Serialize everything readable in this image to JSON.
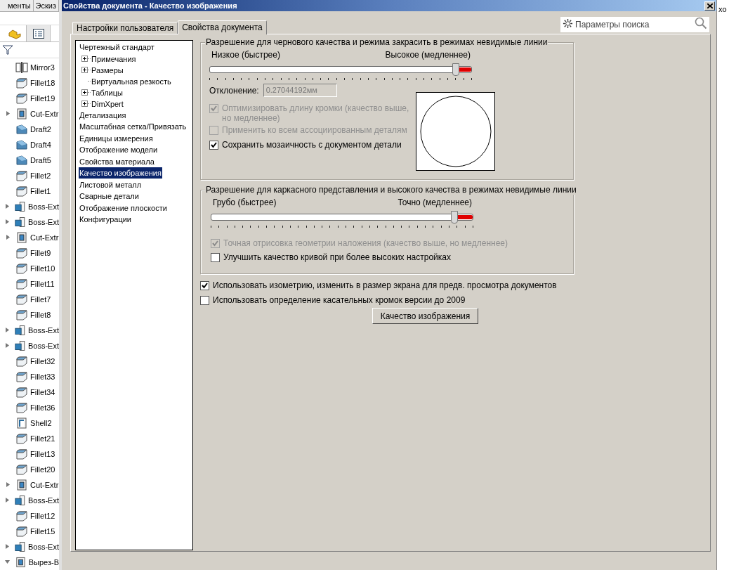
{
  "feature_panel": {
    "top_tabs": [
      {
        "label": "менты",
        "selected": false
      },
      {
        "label": "Эскиз",
        "selected": false
      }
    ],
    "view_tabs": [
      {
        "kind": "part",
        "selected": true
      },
      {
        "kind": "list",
        "selected": false
      }
    ],
    "features": [
      {
        "label": "Mirror3",
        "kind": "mirror"
      },
      {
        "label": "Fillet18",
        "kind": "fillet"
      },
      {
        "label": "Fillet19",
        "kind": "fillet"
      },
      {
        "label": "Cut-Extr",
        "kind": "cut",
        "expanded": false
      },
      {
        "label": "Draft2",
        "kind": "draft"
      },
      {
        "label": "Draft4",
        "kind": "draft"
      },
      {
        "label": "Draft5",
        "kind": "draft"
      },
      {
        "label": "Fillet2",
        "kind": "fillet"
      },
      {
        "label": "Fillet1",
        "kind": "fillet"
      },
      {
        "label": "Boss-Ext",
        "kind": "boss",
        "expanded": false
      },
      {
        "label": "Boss-Ext",
        "kind": "boss",
        "expanded": false
      },
      {
        "label": "Cut-Extr",
        "kind": "cut",
        "expanded": false
      },
      {
        "label": "Fillet9",
        "kind": "fillet"
      },
      {
        "label": "Fillet10",
        "kind": "fillet"
      },
      {
        "label": "Fillet11",
        "kind": "fillet"
      },
      {
        "label": "Fillet7",
        "kind": "fillet"
      },
      {
        "label": "Fillet8",
        "kind": "fillet"
      },
      {
        "label": "Boss-Ext",
        "kind": "boss",
        "expanded": false
      },
      {
        "label": "Boss-Ext",
        "kind": "boss",
        "expanded": false
      },
      {
        "label": "Fillet32",
        "kind": "fillet"
      },
      {
        "label": "Fillet33",
        "kind": "fillet"
      },
      {
        "label": "Fillet34",
        "kind": "fillet"
      },
      {
        "label": "Fillet36",
        "kind": "fillet"
      },
      {
        "label": "Shell2",
        "kind": "shell"
      },
      {
        "label": "Fillet21",
        "kind": "fillet"
      },
      {
        "label": "Fillet13",
        "kind": "fillet"
      },
      {
        "label": "Fillet20",
        "kind": "fillet"
      },
      {
        "label": "Cut-Extr",
        "kind": "cut",
        "expanded": false
      },
      {
        "label": "Boss-Ext",
        "kind": "boss",
        "expanded": false
      },
      {
        "label": "Fillet12",
        "kind": "fillet"
      },
      {
        "label": "Fillet15",
        "kind": "fillet"
      },
      {
        "label": "Boss-Ext",
        "kind": "boss",
        "expanded": false
      },
      {
        "label": "Вырез-В",
        "kind": "cut",
        "expanded": true
      }
    ]
  },
  "dialog": {
    "title": "Свойства документа - Качество изображения",
    "tabs": [
      {
        "label": "Настройки пользователя",
        "selected": false
      },
      {
        "label": "Свойства документа",
        "selected": true
      }
    ],
    "search": {
      "placeholder": "Параметры поиска"
    },
    "nav": [
      {
        "label": "Чертежный стандарт",
        "selected": false,
        "children": [
          {
            "label": "Примечания",
            "expandable": true,
            "selected": false
          },
          {
            "label": "Размеры",
            "expandable": true,
            "selected": false
          },
          {
            "label": "Виртуальная резкость",
            "expandable": false,
            "selected": false
          },
          {
            "label": "Таблицы",
            "expandable": true,
            "selected": false
          },
          {
            "label": "DimXpert",
            "expandable": true,
            "selected": false
          }
        ]
      },
      {
        "label": "Детализация",
        "selected": false
      },
      {
        "label": "Масштабная сетка/Привязать",
        "selected": false
      },
      {
        "label": "Единицы измерения",
        "selected": false
      },
      {
        "label": "Отображение модели",
        "selected": false
      },
      {
        "label": "Свойства материала",
        "selected": false
      },
      {
        "label": "Качество изображения",
        "selected": true
      },
      {
        "label": "Листовой металл",
        "selected": false
      },
      {
        "label": "Сварные детали",
        "selected": false
      },
      {
        "label": "Отображение плоскости",
        "selected": false
      },
      {
        "label": "Конфигурации",
        "selected": false
      }
    ],
    "shaded_group": {
      "title": "Разрешение для чернового качества и режима закрасить в режимах невидимые линии",
      "low_label": "Низкое (быстрее)",
      "high_label": "Высокое (медленнее)",
      "level": 0.94,
      "deviation_label": "Отклонение:",
      "deviation_value": "0.27044192мм",
      "options": [
        {
          "label": "Оптимизировать длину кромки (качество выше, но медленнее)",
          "checked": true,
          "disabled": true
        },
        {
          "label": "Применить ко всем ассоциированным деталям",
          "checked": false,
          "disabled": true
        },
        {
          "label": "Сохранить мозаичность с документом детали",
          "checked": true,
          "disabled": false
        }
      ]
    },
    "wireframe_group": {
      "title": "Разрешение для каркасного представления и высокого качества в режимах невидимые линии",
      "low_label": "Грубо (быстрее)",
      "high_label": "Точно (медленнее)",
      "level": 0.93,
      "options": [
        {
          "label": "Точная отрисовка геометрии наложения (качество выше, но медленнее)",
          "checked": true,
          "disabled": true
        },
        {
          "label": "Улучшить качество кривой при более высоких настройках",
          "checked": false,
          "disabled": false
        }
      ]
    },
    "options": [
      {
        "label": "Использовать изометрию, изменить в размер экрана для предв. просмотра документов",
        "checked": true,
        "disabled": false
      },
      {
        "label": "Использовать определение касательных кромок версии до 2009",
        "checked": false,
        "disabled": false
      }
    ],
    "image_quality_button": "Качество изображения"
  },
  "right_strip": {
    "text": "хо"
  }
}
